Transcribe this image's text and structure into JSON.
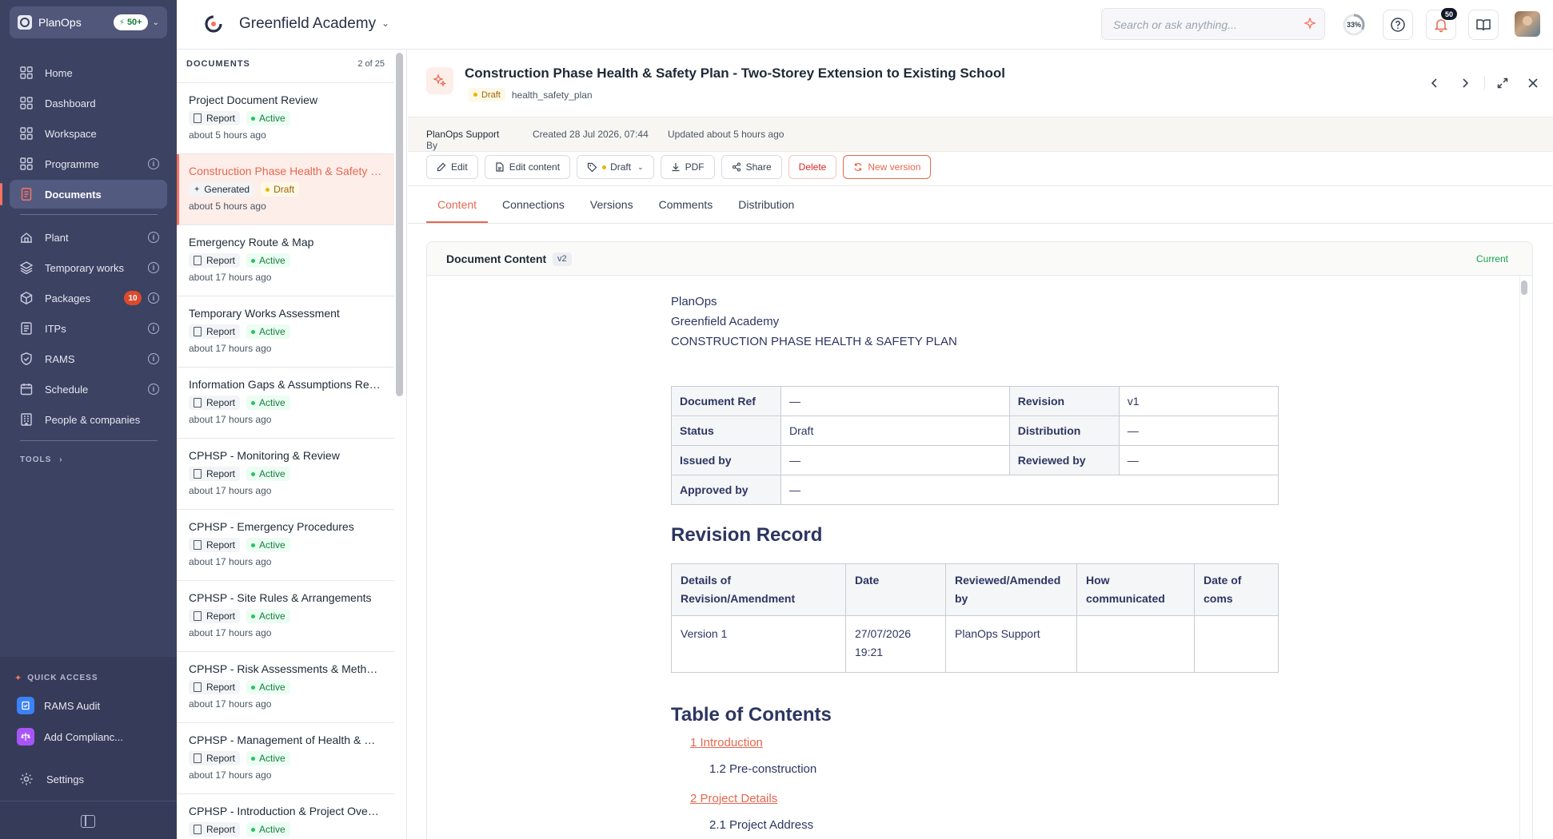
{
  "workspace": {
    "name": "PlanOps",
    "badge": "50+"
  },
  "nav": {
    "main": [
      {
        "label": "Home",
        "icon": "grid-icon"
      },
      {
        "label": "Dashboard",
        "icon": "grid-icon"
      },
      {
        "label": "Workspace",
        "icon": "grid-icon"
      },
      {
        "label": "Programme",
        "icon": "grid-icon"
      },
      {
        "label": "Documents",
        "icon": "document-icon"
      }
    ],
    "secondary": [
      {
        "label": "Plant",
        "icon": "plant-icon"
      },
      {
        "label": "Temporary works",
        "icon": "layers-icon"
      },
      {
        "label": "Packages",
        "icon": "package-icon",
        "count": "10"
      },
      {
        "label": "ITPs",
        "icon": "checklist-icon"
      },
      {
        "label": "RAMS",
        "icon": "shield-icon"
      },
      {
        "label": "Schedule",
        "icon": "calendar-icon"
      },
      {
        "label": "People & companies",
        "icon": "building-icon"
      }
    ],
    "tools_label": "TOOLS",
    "quick_access_label": "QUICK ACCESS",
    "quick_access": [
      {
        "label": "RAMS Audit",
        "icon": "rams-audit-icon",
        "color": "#3b82f6"
      },
      {
        "label": "Add Complianc...",
        "icon": "compliance-icon",
        "color": "#a855f7"
      }
    ],
    "settings_label": "Settings"
  },
  "topbar": {
    "project_name": "Greenfield Academy",
    "search_placeholder": "Search or ask anything...",
    "progress_label": "33%",
    "progress_value": 0.33,
    "notifications_count": "50"
  },
  "doclist": {
    "title": "DOCUMENTS",
    "count": "2 of 25",
    "items": [
      {
        "title": "Project Document Review",
        "type": "Report",
        "status": "Active",
        "time": "about 5 hours ago"
      },
      {
        "title": "Construction Phase Health & Safety Plan - Two-Storey Extension to Existing School",
        "type": "Generated",
        "status": "Draft",
        "time": "about 5 hours ago"
      },
      {
        "title": "Emergency Route & Map",
        "type": "Report",
        "status": "Active",
        "time": "about 17 hours ago"
      },
      {
        "title": "Temporary Works Assessment",
        "type": "Report",
        "status": "Active",
        "time": "about 17 hours ago"
      },
      {
        "title": "Information Gaps & Assumptions Register",
        "type": "Report",
        "status": "Active",
        "time": "about 17 hours ago"
      },
      {
        "title": "CPHSP - Monitoring & Review",
        "type": "Report",
        "status": "Active",
        "time": "about 17 hours ago"
      },
      {
        "title": "CPHSP - Emergency Procedures",
        "type": "Report",
        "status": "Active",
        "time": "about 17 hours ago"
      },
      {
        "title": "CPHSP - Site Rules & Arrangements",
        "type": "Report",
        "status": "Active",
        "time": "about 17 hours ago"
      },
      {
        "title": "CPHSP - Risk Assessments & Method Statements",
        "type": "Report",
        "status": "Active",
        "time": "about 17 hours ago"
      },
      {
        "title": "CPHSP - Management of Health & Safety",
        "type": "Report",
        "status": "Active",
        "time": "about 17 hours ago"
      },
      {
        "title": "CPHSP - Introduction & Project Overview",
        "type": "Report",
        "status": "Active",
        "time": ""
      }
    ]
  },
  "document": {
    "title": "Construction Phase Health & Safety Plan - Two-Storey Extension to Existing School",
    "status": "Draft",
    "doc_type": "health_safety_plan",
    "by_prefix": "By",
    "author": "PlanOps Support",
    "created": "Created 28 Jul 2026, 07:44",
    "updated": "Updated about 5 hours ago",
    "actions": {
      "edit": "Edit",
      "edit_content": "Edit content",
      "status": "Draft",
      "pdf": "PDF",
      "share": "Share",
      "delete": "Delete",
      "new_version": "New version"
    },
    "tabs": [
      "Content",
      "Connections",
      "Versions",
      "Comments",
      "Distribution"
    ],
    "content_header": {
      "title": "Document Content",
      "version": "v2",
      "current": "Current"
    },
    "body": {
      "address": [
        "PlanOps",
        "Greenfield Academy",
        "CONSTRUCTION PHASE HEALTH & SAFETY PLAN"
      ],
      "meta_table": {
        "doc_ref_label": "Document Ref",
        "doc_ref": "—",
        "revision_label": "Revision",
        "revision": "v1",
        "status_label": "Status",
        "status": "Draft",
        "distribution_label": "Distribution",
        "distribution": "—",
        "issued_label": "Issued by",
        "issued": "—",
        "reviewed_label": "Reviewed by",
        "reviewed": "—",
        "approved_label": "Approved by",
        "approved": "—"
      },
      "revision_heading": "Revision Record",
      "revision_table": {
        "headers": [
          "Details of Revision/Amendment",
          "Date",
          "Reviewed/Amended by",
          "How communicated",
          "Date of coms"
        ],
        "row": [
          "Version 1",
          "27/07/2026 19:21",
          "PlanOps Support",
          "",
          ""
        ]
      },
      "toc_heading": "Table of Contents",
      "toc": [
        "1 Introduction",
        "1.2 Pre-construction",
        "2 Project Details",
        "2.1 Project Address"
      ]
    }
  }
}
